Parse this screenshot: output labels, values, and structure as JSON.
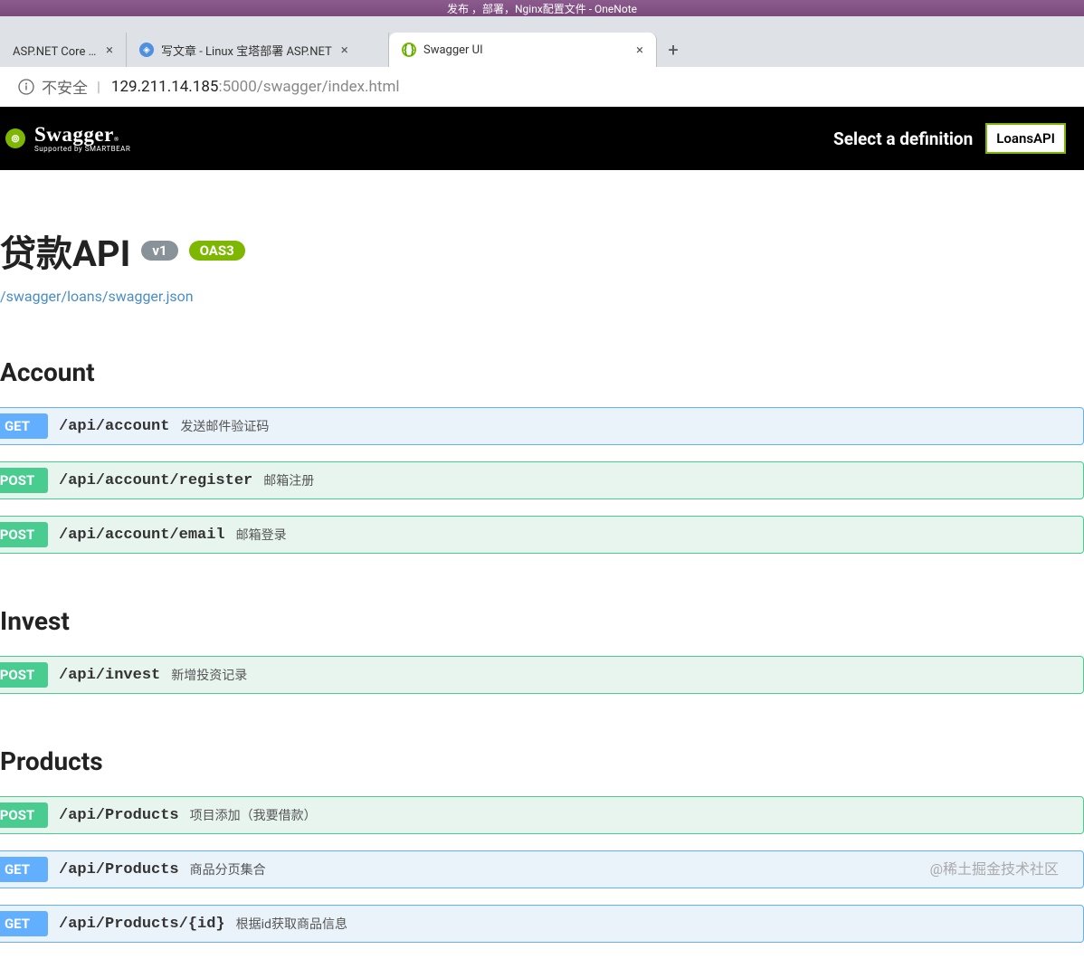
{
  "window": {
    "title": "发布 ，部署，Nginx配置文件 - OneNote"
  },
  "tabs": [
    {
      "label": "ASP.NET Core 应"
    },
    {
      "label": "写文章 - Linux 宝塔部署 ASP.NET"
    },
    {
      "label": "Swagger UI"
    }
  ],
  "newtab_glyph": "+",
  "address": {
    "insecure_label": "不安全",
    "sep": "|",
    "host": "129.211.14.185",
    "port": ":5000",
    "path": "/swagger/index.html"
  },
  "header": {
    "brand": "Swagger",
    "sub": "Supported by SMARTBEAR",
    "select_label": "Select a definition",
    "select_value": "LoansAPI"
  },
  "api": {
    "title": "贷款API",
    "version_pill": "v1",
    "oas_pill": "OAS3",
    "json_link": "/swagger/loans/swagger.json"
  },
  "sections": [
    {
      "name": "Account",
      "ops": [
        {
          "method": "GET",
          "path": "/api/account",
          "desc": "发送邮件验证码"
        },
        {
          "method": "POST",
          "path": "/api/account/register",
          "desc": "邮箱注册"
        },
        {
          "method": "POST",
          "path": "/api/account/email",
          "desc": "邮箱登录"
        }
      ]
    },
    {
      "name": "Invest",
      "ops": [
        {
          "method": "POST",
          "path": "/api/invest",
          "desc": "新增投资记录"
        }
      ]
    },
    {
      "name": "Products",
      "ops": [
        {
          "method": "POST",
          "path": "/api/Products",
          "desc": "项目添加（我要借款）"
        },
        {
          "method": "GET",
          "path": "/api/Products",
          "desc": "商品分页集合"
        },
        {
          "method": "GET",
          "path": "/api/Products/{id}",
          "desc": "根据id获取商品信息"
        }
      ]
    }
  ],
  "watermark": "@稀土掘金技术社区"
}
